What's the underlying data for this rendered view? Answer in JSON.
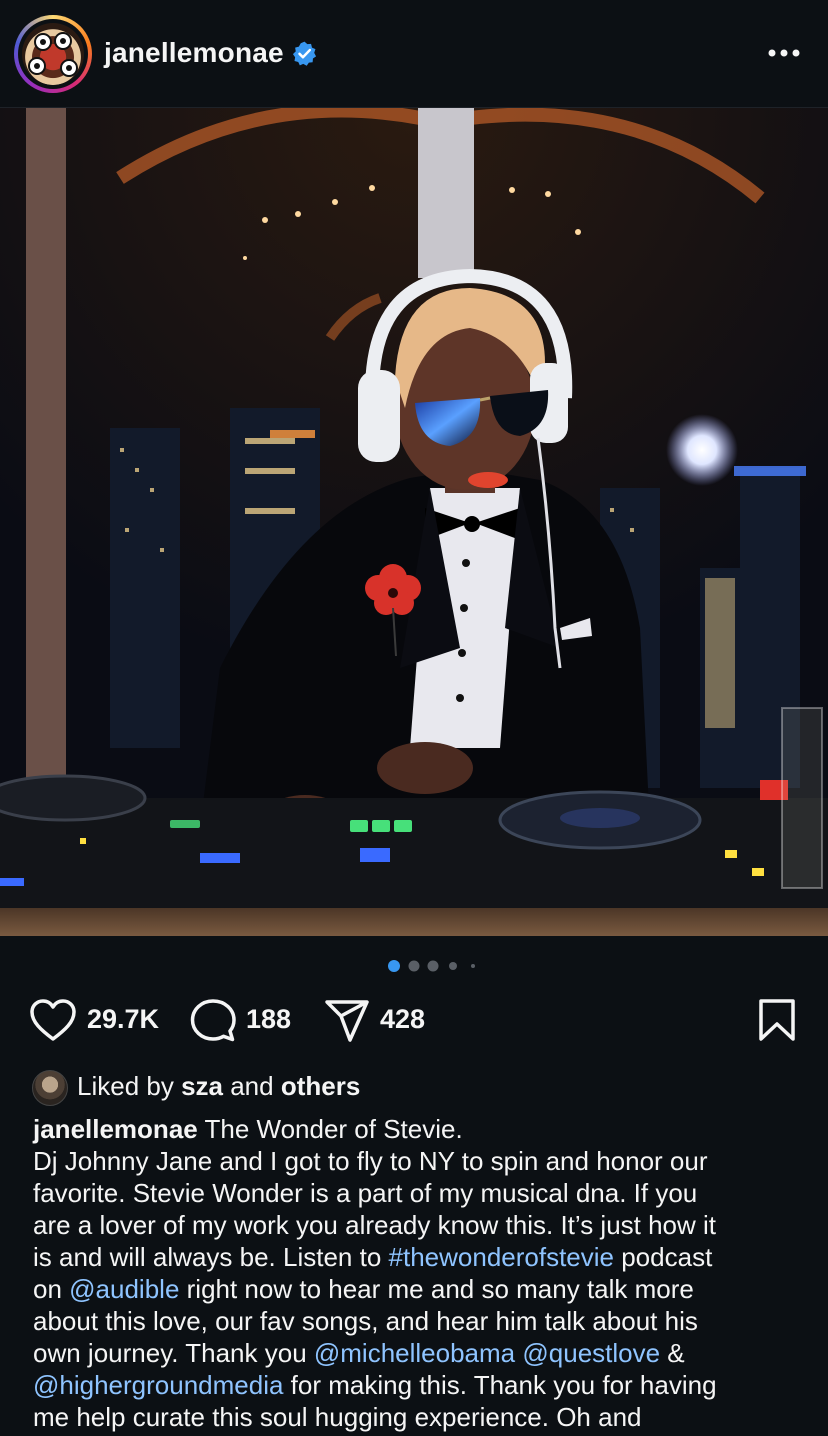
{
  "post": {
    "username": "janellemonae",
    "verified": true
  },
  "carousel": {
    "count": 5,
    "active_index": 0
  },
  "actions": {
    "likes": "29.7K",
    "comments": "188",
    "shares": "428"
  },
  "liked_by": {
    "prefix": "Liked by ",
    "user": "sza",
    "middle": " and ",
    "others": "others"
  },
  "caption": {
    "username": "janellemonae",
    "title": " The Wonder of Stevie.",
    "lines": [
      [
        {
          "t": "Dj Johnny Jane and I got to fly to NY to spin and honor our"
        }
      ],
      [
        {
          "t": "favorite. Stevie Wonder is a part of my musical dna. If you"
        }
      ],
      [
        {
          "t": "are a lover of my work you already know this. It’s just how it"
        }
      ],
      [
        {
          "t": "is and will always be. Listen to "
        },
        {
          "t": "#thewonderofstevie",
          "tag": true
        },
        {
          "t": " podcast"
        }
      ],
      [
        {
          "t": "on "
        },
        {
          "t": "@audible",
          "tag": true
        },
        {
          "t": " right now to hear me and so many talk more"
        }
      ],
      [
        {
          "t": "about this love, our fav songs, and hear him talk about his"
        }
      ],
      [
        {
          "t": "own journey. Thank you "
        },
        {
          "t": "@michelleobama",
          "tag": true
        },
        {
          "t": " "
        },
        {
          "t": "@questlove",
          "tag": true
        },
        {
          "t": " &"
        }
      ],
      [
        {
          "t": "@highergroundmedia",
          "tag": true
        },
        {
          "t": " for making this. Thank you for having"
        }
      ],
      [
        {
          "t": "me help curate this soul hugging experience. Oh and"
        }
      ]
    ]
  },
  "colors": {
    "background": "#0c1014",
    "text": "#f5f5f5",
    "link": "#8fc4ff",
    "verified": "#3897f0",
    "dot_active": "#3897f0",
    "dot_inactive": "#5a5f66"
  },
  "icons": [
    "more-options-icon",
    "verified-badge-icon",
    "heart-icon",
    "comment-icon",
    "share-icon",
    "bookmark-icon"
  ]
}
